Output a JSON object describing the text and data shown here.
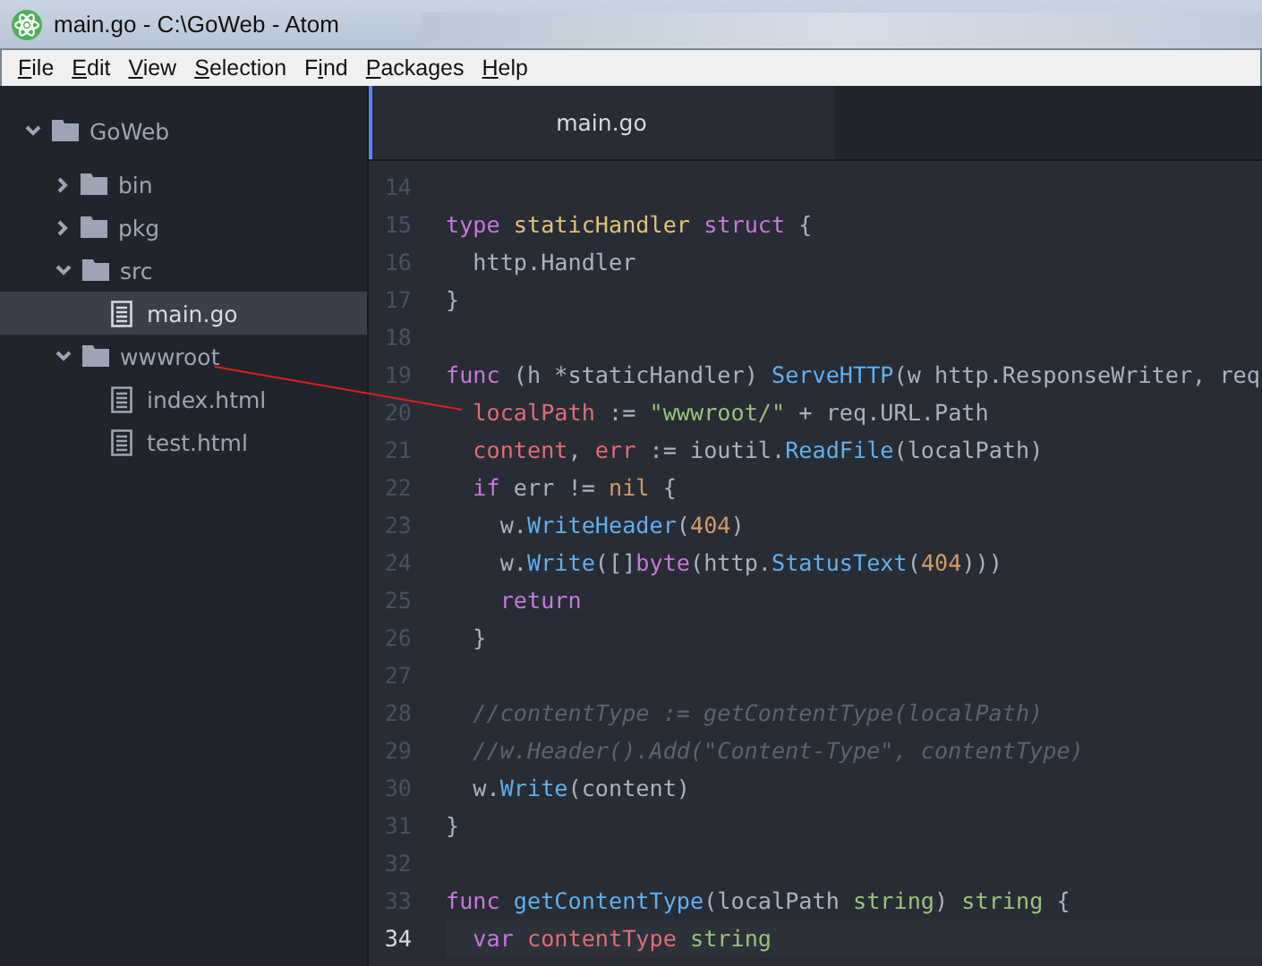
{
  "window": {
    "title": "main.go - C:\\GoWeb - Atom"
  },
  "menu": [
    {
      "access_key": "F",
      "rest": "ile"
    },
    {
      "access_key": "E",
      "rest": "dit"
    },
    {
      "access_key": "V",
      "rest": "iew"
    },
    {
      "access_key": "S",
      "rest": "election"
    },
    {
      "lead": "F",
      "access_key": "i",
      "rest": "nd"
    },
    {
      "access_key": "P",
      "rest": "ackages"
    },
    {
      "access_key": "H",
      "rest": "elp"
    }
  ],
  "tree": {
    "label": "GoWeb",
    "kind": "folder",
    "expanded": true,
    "children": [
      {
        "label": "bin",
        "kind": "folder",
        "expanded": false,
        "selected": false
      },
      {
        "label": "pkg",
        "kind": "folder",
        "expanded": false,
        "selected": false
      },
      {
        "label": "src",
        "kind": "folder",
        "expanded": true,
        "selected": false,
        "children": [
          {
            "label": "main.go",
            "kind": "file",
            "selected": true
          }
        ]
      },
      {
        "label": "wwwroot",
        "kind": "folder",
        "expanded": true,
        "selected": false,
        "children": [
          {
            "label": "index.html",
            "kind": "file",
            "selected": false
          },
          {
            "label": "test.html",
            "kind": "file",
            "selected": false
          }
        ]
      }
    ]
  },
  "tabs": [
    {
      "label": "main.go",
      "selected": true
    }
  ],
  "editor": {
    "lines": [
      {
        "number": "14",
        "current": false
      },
      {
        "number": "15",
        "current": false,
        "tokens": [
          {
            "kind": "kw",
            "text": "type "
          },
          {
            "kind": "type",
            "text": "staticHandler "
          },
          {
            "kind": "kw",
            "text": "struct"
          },
          {
            "kind": "plain",
            "text": " {"
          }
        ]
      },
      {
        "number": "16",
        "current": false,
        "tokens": [
          {
            "kind": "plain",
            "text": "  http.Handler"
          }
        ]
      },
      {
        "number": "17",
        "current": false,
        "tokens": [
          {
            "kind": "plain",
            "text": "}"
          }
        ]
      },
      {
        "number": "18",
        "current": false
      },
      {
        "number": "19",
        "current": false,
        "tokens": [
          {
            "kind": "kw",
            "text": "func"
          },
          {
            "kind": "plain",
            "text": " (h *staticHandler) "
          },
          {
            "kind": "fn",
            "text": "ServeHTTP"
          },
          {
            "kind": "plain",
            "text": "(w http.ResponseWriter, req"
          }
        ]
      },
      {
        "number": "20",
        "current": false,
        "tokens": [
          {
            "kind": "var",
            "text": "  localPath"
          },
          {
            "kind": "plain",
            "text": " := "
          },
          {
            "kind": "str",
            "text": "\"wwwroot/\""
          },
          {
            "kind": "plain",
            "text": " + req.URL.Path"
          }
        ]
      },
      {
        "number": "21",
        "current": false,
        "tokens": [
          {
            "kind": "var",
            "text": "  content"
          },
          {
            "kind": "plain",
            "text": ", "
          },
          {
            "kind": "var",
            "text": "err"
          },
          {
            "kind": "plain",
            "text": " := ioutil."
          },
          {
            "kind": "fn",
            "text": "ReadFile"
          },
          {
            "kind": "plain",
            "text": "(localPath)"
          }
        ]
      },
      {
        "number": "22",
        "current": false,
        "tokens": [
          {
            "kind": "kw",
            "text": "  if"
          },
          {
            "kind": "plain",
            "text": " err != "
          },
          {
            "kind": "num",
            "text": "nil"
          },
          {
            "kind": "plain",
            "text": " {"
          }
        ]
      },
      {
        "number": "23",
        "current": false,
        "tokens": [
          {
            "kind": "plain",
            "text": "    w."
          },
          {
            "kind": "fn",
            "text": "WriteHeader"
          },
          {
            "kind": "plain",
            "text": "("
          },
          {
            "kind": "num",
            "text": "404"
          },
          {
            "kind": "plain",
            "text": ")"
          }
        ]
      },
      {
        "number": "24",
        "current": false,
        "tokens": [
          {
            "kind": "plain",
            "text": "    w."
          },
          {
            "kind": "fn",
            "text": "Write"
          },
          {
            "kind": "plain",
            "text": "([]"
          },
          {
            "kind": "kw",
            "text": "byte"
          },
          {
            "kind": "plain",
            "text": "(http."
          },
          {
            "kind": "fn",
            "text": "StatusText"
          },
          {
            "kind": "plain",
            "text": "("
          },
          {
            "kind": "num",
            "text": "404"
          },
          {
            "kind": "plain",
            "text": ")))"
          }
        ]
      },
      {
        "number": "25",
        "current": false,
        "tokens": [
          {
            "kind": "kw",
            "text": "    return"
          }
        ]
      },
      {
        "number": "26",
        "current": false,
        "tokens": [
          {
            "kind": "plain",
            "text": "  }"
          }
        ]
      },
      {
        "number": "27",
        "current": false
      },
      {
        "number": "28",
        "current": false,
        "tokens": [
          {
            "kind": "cmt",
            "text": "  //contentType := getContentType(localPath)"
          }
        ]
      },
      {
        "number": "29",
        "current": false,
        "tokens": [
          {
            "kind": "cmt",
            "text": "  //w.Header().Add(\"Content-Type\", contentType)"
          }
        ]
      },
      {
        "number": "30",
        "current": false,
        "tokens": [
          {
            "kind": "plain",
            "text": "  w."
          },
          {
            "kind": "fn",
            "text": "Write"
          },
          {
            "kind": "plain",
            "text": "(content)"
          }
        ]
      },
      {
        "number": "31",
        "current": false,
        "tokens": [
          {
            "kind": "plain",
            "text": "}"
          }
        ]
      },
      {
        "number": "32",
        "current": false
      },
      {
        "number": "33",
        "current": false,
        "tokens": [
          {
            "kind": "kw",
            "text": "func "
          },
          {
            "kind": "fn",
            "text": "getContentType"
          },
          {
            "kind": "plain",
            "text": "(localPath "
          },
          {
            "kind": "str",
            "text": "string"
          },
          {
            "kind": "plain",
            "text": ") "
          },
          {
            "kind": "str",
            "text": "string"
          },
          {
            "kind": "plain",
            "text": " {"
          }
        ]
      },
      {
        "number": "34",
        "current": true,
        "tokens": [
          {
            "kind": "kw",
            "text": "  var "
          },
          {
            "kind": "var",
            "text": "contentType "
          },
          {
            "kind": "str",
            "text": "string"
          }
        ]
      }
    ]
  }
}
